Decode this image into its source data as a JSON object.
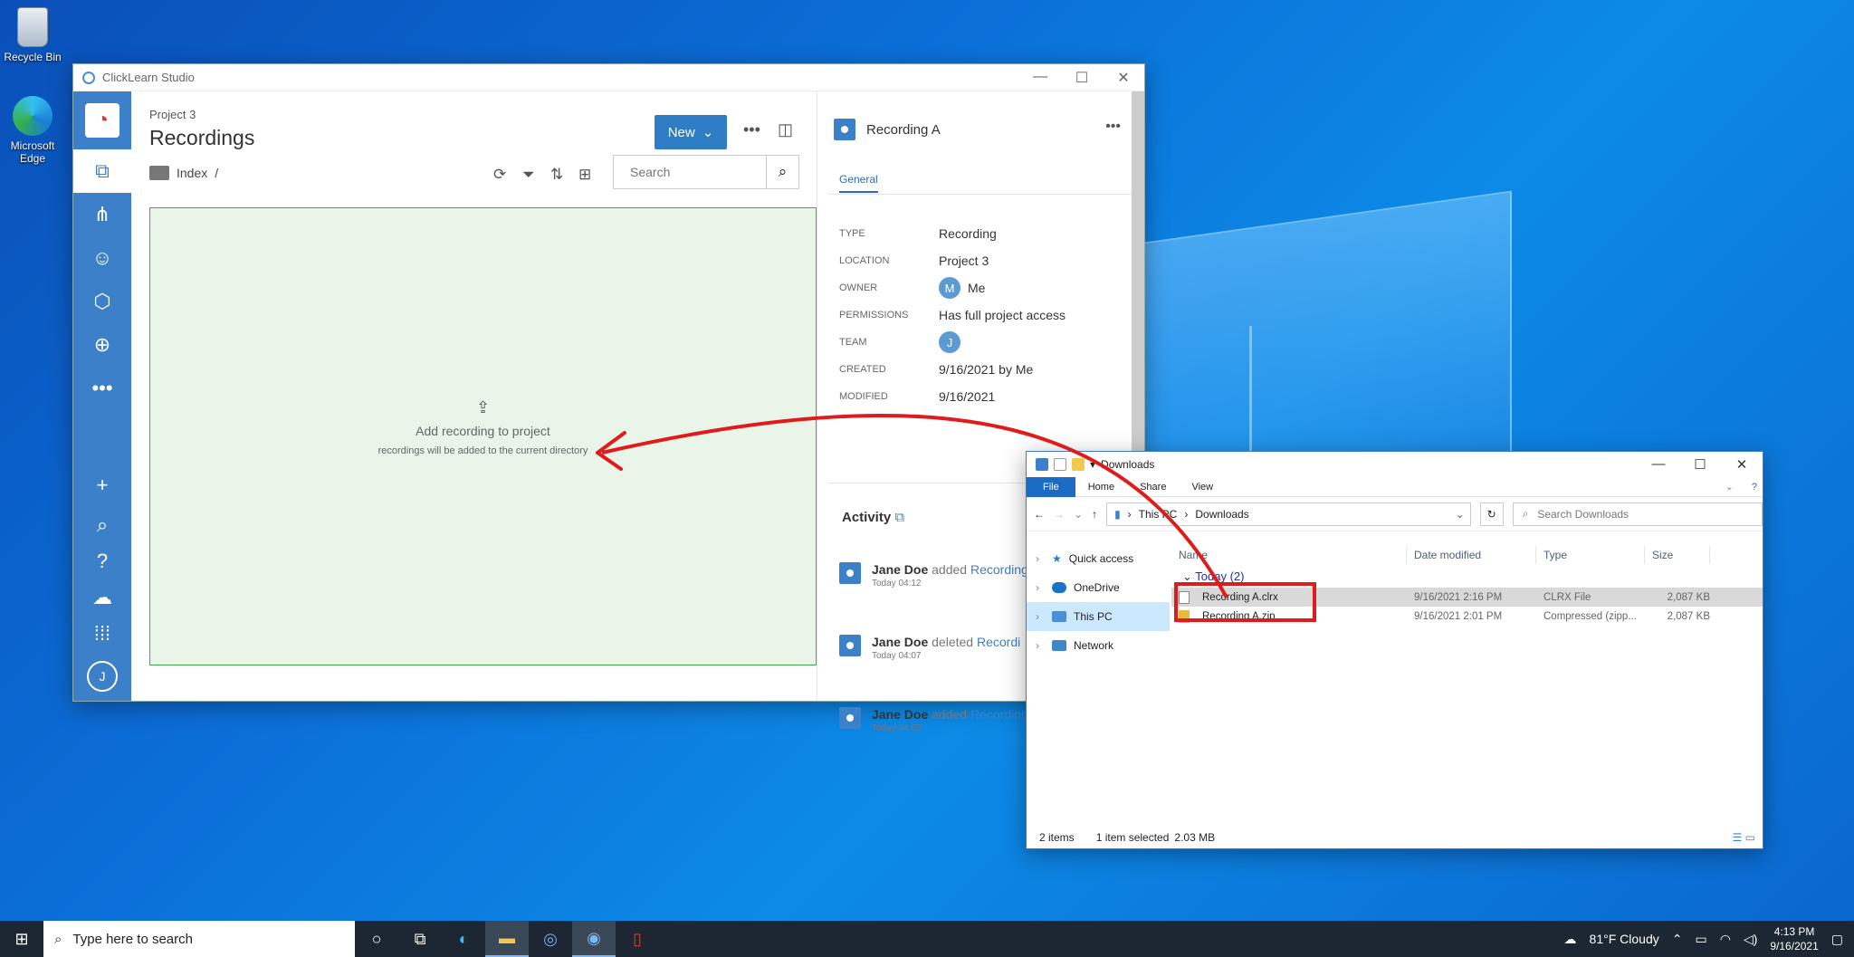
{
  "desktop": {
    "icons": [
      {
        "label": "Recycle Bin"
      },
      {
        "label": "Microsoft Edge"
      }
    ]
  },
  "clicklearn": {
    "window_title": "ClickLearn Studio",
    "project_label": "Project 3",
    "page_title": "Recordings",
    "new_button": "New",
    "breadcrumb": "Index",
    "breadcrumb_sep": "/",
    "search_placeholder": "Search",
    "dropzone": {
      "title": "Add recording to project",
      "subtitle": "recordings will be added to the current directory"
    },
    "sidebar_avatar": "J",
    "detail": {
      "title": "Recording A",
      "tab": "General",
      "properties": [
        {
          "key": "TYPE",
          "value": "Recording"
        },
        {
          "key": "LOCATION",
          "value": "Project 3"
        },
        {
          "key": "OWNER",
          "value": "Me",
          "avatar": "M"
        },
        {
          "key": "PERMISSIONS",
          "value": "Has full project access"
        },
        {
          "key": "TEAM",
          "value": "",
          "avatar": "J"
        },
        {
          "key": "CREATED",
          "value": "9/16/2021 by Me"
        },
        {
          "key": "MODIFIED",
          "value": "9/16/2021"
        }
      ],
      "activity_title": "Activity",
      "activity": [
        {
          "user": "Jane Doe",
          "verb": "added",
          "object": "Recording",
          "time": "Today 04:12"
        },
        {
          "user": "Jane Doe",
          "verb": "deleted",
          "object": "Recordi",
          "time": "Today 04:07"
        },
        {
          "user": "Jane Doe",
          "verb": "added",
          "object": "Recording",
          "time": "Today 04:05"
        }
      ]
    }
  },
  "explorer": {
    "title": "Downloads",
    "ribbon": [
      "File",
      "Home",
      "Share",
      "View"
    ],
    "address": [
      "This PC",
      "Downloads"
    ],
    "search_placeholder": "Search Downloads",
    "nav": [
      "Quick access",
      "OneDrive",
      "This PC",
      "Network"
    ],
    "columns": [
      "Name",
      "Date modified",
      "Type",
      "Size"
    ],
    "group": "Today (2)",
    "files": [
      {
        "name": "Recording A.clrx",
        "date": "9/16/2021 2:16 PM",
        "type": "CLRX File",
        "size": "2,087 KB"
      },
      {
        "name": "Recording A.zip",
        "date": "9/16/2021 2:01 PM",
        "type": "Compressed (zipp...",
        "size": "2,087 KB"
      }
    ],
    "status": {
      "items": "2 items",
      "selected": "1 item selected",
      "size": "2.03 MB"
    }
  },
  "taskbar": {
    "search_placeholder": "Type here to search",
    "weather": "81°F  Cloudy",
    "time": "4:13 PM",
    "date": "9/16/2021"
  }
}
